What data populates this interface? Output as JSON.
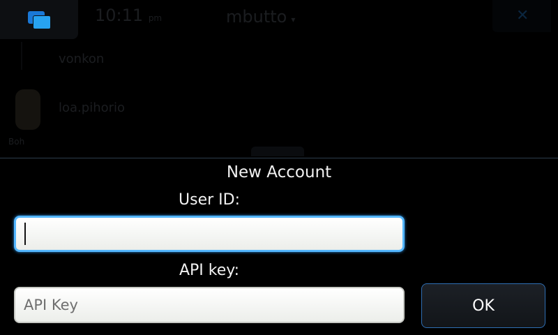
{
  "background": {
    "time": "10:11",
    "time_suffix": "pm",
    "app_name": "mbutto",
    "app_name_caret": "▾",
    "close_glyph": "✕",
    "row1_text": "vonkon",
    "row2_text": "loa.pihorio",
    "avatar_label": "Boh"
  },
  "dialog": {
    "title": "New Account",
    "user_id_label": "User ID:",
    "user_id_value": "",
    "api_key_label": "API key:",
    "api_key_placeholder": "API Key",
    "ok_label": "OK"
  },
  "icons": {
    "task_switcher": "task-switcher-icon",
    "close": "close-icon"
  },
  "colors": {
    "focus_border": "#53b6ff",
    "task_switcher_blue": "#27a2f0",
    "ok_border": "#2f6fb4"
  }
}
